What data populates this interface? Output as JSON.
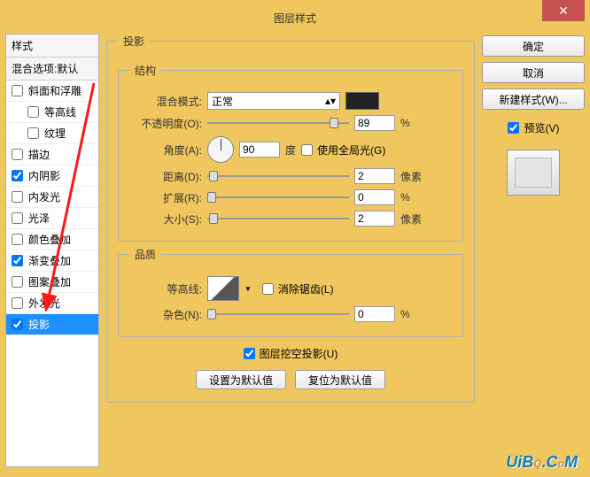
{
  "title": "图层样式",
  "close": "✕",
  "left": {
    "header": "样式",
    "sub": "混合选项:默认",
    "effects": [
      {
        "label": "斜面和浮雕",
        "checked": false,
        "indent": false
      },
      {
        "label": "等高线",
        "checked": false,
        "indent": true
      },
      {
        "label": "纹理",
        "checked": false,
        "indent": true
      },
      {
        "label": "描边",
        "checked": false,
        "indent": false
      },
      {
        "label": "内阴影",
        "checked": true,
        "indent": false
      },
      {
        "label": "内发光",
        "checked": false,
        "indent": false
      },
      {
        "label": "光泽",
        "checked": false,
        "indent": false
      },
      {
        "label": "颜色叠加",
        "checked": false,
        "indent": false
      },
      {
        "label": "渐变叠加",
        "checked": true,
        "indent": false
      },
      {
        "label": "图案叠加",
        "checked": false,
        "indent": false
      },
      {
        "label": "外发光",
        "checked": false,
        "indent": false
      },
      {
        "label": "投影",
        "checked": true,
        "indent": false,
        "selected": true
      }
    ]
  },
  "mid": {
    "section_title": "投影",
    "structure_title": "结构",
    "blend_label": "混合模式:",
    "blend_value": "正常",
    "opacity_label": "不透明度(O):",
    "opacity_value": "89",
    "opacity_unit": "%",
    "angle_label": "角度(A):",
    "angle_value": "90",
    "angle_unit": "度",
    "global_light_label": "使用全局光(G)",
    "distance_label": "距离(D):",
    "distance_value": "2",
    "distance_unit": "像素",
    "spread_label": "扩展(R):",
    "spread_value": "0",
    "spread_unit": "%",
    "size_label": "大小(S):",
    "size_value": "2",
    "size_unit": "像素",
    "quality_title": "品质",
    "contour_label": "等高线:",
    "antialias_label": "消除锯齿(L)",
    "noise_label": "杂色(N):",
    "noise_value": "0",
    "noise_unit": "%",
    "knockout_label": "图层挖空投影(U)",
    "default_btn": "设置为默认值",
    "reset_btn": "复位为默认值"
  },
  "right": {
    "ok": "确定",
    "cancel": "取消",
    "new_style": "新建样式(W)...",
    "preview_label": "预览(V)"
  },
  "watermark": "UiBQ.CoM"
}
